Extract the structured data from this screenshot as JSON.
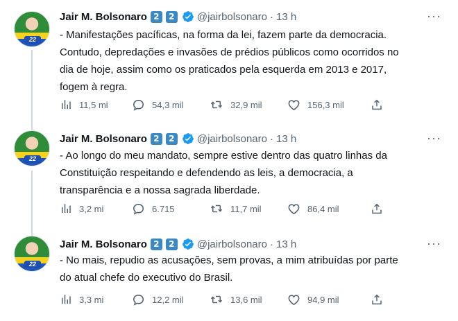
{
  "author": {
    "name": "Jair M. Bolsonaro",
    "emoji_digits": [
      "2",
      "2"
    ],
    "handle": "@jairbolsonaro",
    "avatar_badge": "22"
  },
  "separator": "·",
  "more_label": "···",
  "tweets": [
    {
      "time": "13 h",
      "lines": [
        "- Manifestações pacíficas, na forma da lei, fazem parte da democracia.",
        "Contudo, depredações e invasões de prédios públicos como ocorridos no",
        "dia de hoje, assim como os praticados pela esquerda em 2013 e 2017,",
        "fogem à regra."
      ],
      "views": "11,5 mi",
      "replies": "54,3 mil",
      "retweets": "32,9 mil",
      "likes": "156,3 mil"
    },
    {
      "time": "13 h",
      "lines": [
        "- Ao longo do meu mandato, sempre estive dentro das quatro linhas da",
        "Constituição respeitando e defendendo as leis, a democracia, a",
        "transparência e a nossa sagrada liberdade."
      ],
      "views": "3,2 mi",
      "replies": "6.715",
      "retweets": "11,7 mil",
      "likes": "86,4 mil"
    },
    {
      "time": "13 h",
      "lines": [
        "- No mais, repudio as acusações, sem provas, a mim atribuídas por parte",
        "do atual chefe do executivo do Brasil."
      ],
      "views": "3,3 mi",
      "replies": "12,2 mil",
      "retweets": "13,6 mil",
      "likes": "94,9 mil"
    }
  ],
  "icons": {
    "views": "analytics-icon",
    "reply": "reply-icon",
    "retweet": "retweet-icon",
    "like": "heart-icon",
    "share": "share-icon",
    "verified": "verified-icon"
  },
  "colors": {
    "text": "#0f1419",
    "muted": "#536471",
    "verified": "#1d9bf0",
    "keycap": "#3b88c3",
    "thread_line": "#cfd9de"
  }
}
